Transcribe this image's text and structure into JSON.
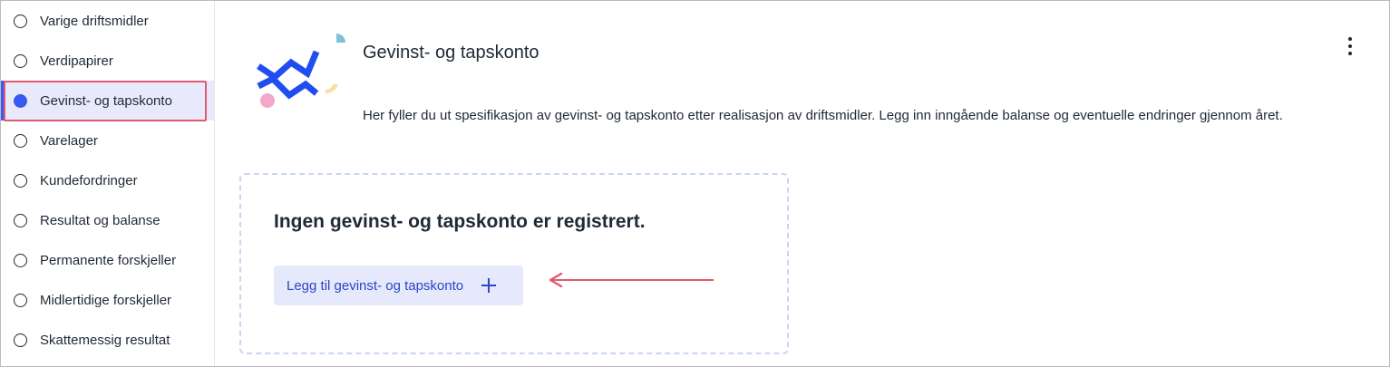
{
  "sidebar": {
    "items": [
      {
        "label": "Varige driftsmidler",
        "active": false
      },
      {
        "label": "Verdipapirer",
        "active": false
      },
      {
        "label": "Gevinst- og tapskonto",
        "active": true
      },
      {
        "label": "Varelager",
        "active": false
      },
      {
        "label": "Kundefordringer",
        "active": false
      },
      {
        "label": "Resultat og balanse",
        "active": false
      },
      {
        "label": "Permanente forskjeller",
        "active": false
      },
      {
        "label": "Midlertidige forskjeller",
        "active": false
      },
      {
        "label": "Skattemessig resultat",
        "active": false
      }
    ]
  },
  "header": {
    "title": "Gevinst- og tapskonto",
    "description": "Her fyller du ut spesifikasjon av gevinst- og tapskonto etter realisasjon av driftsmidler. Legg inn inngående balanse og eventuelle endringer gjennom året."
  },
  "empty_state": {
    "heading": "Ingen gevinst- og tapskonto er registrert.",
    "add_button_label": "Legg til gevinst- og tapskonto"
  },
  "colors": {
    "accent": "#3a59f0",
    "annotation": "#e05b6f",
    "button_bg": "#e6e9fb",
    "button_text": "#2a46c9"
  },
  "icons": {
    "menu": "kebab-menu-icon",
    "add": "plus-icon",
    "logo": "illustration-logo"
  }
}
